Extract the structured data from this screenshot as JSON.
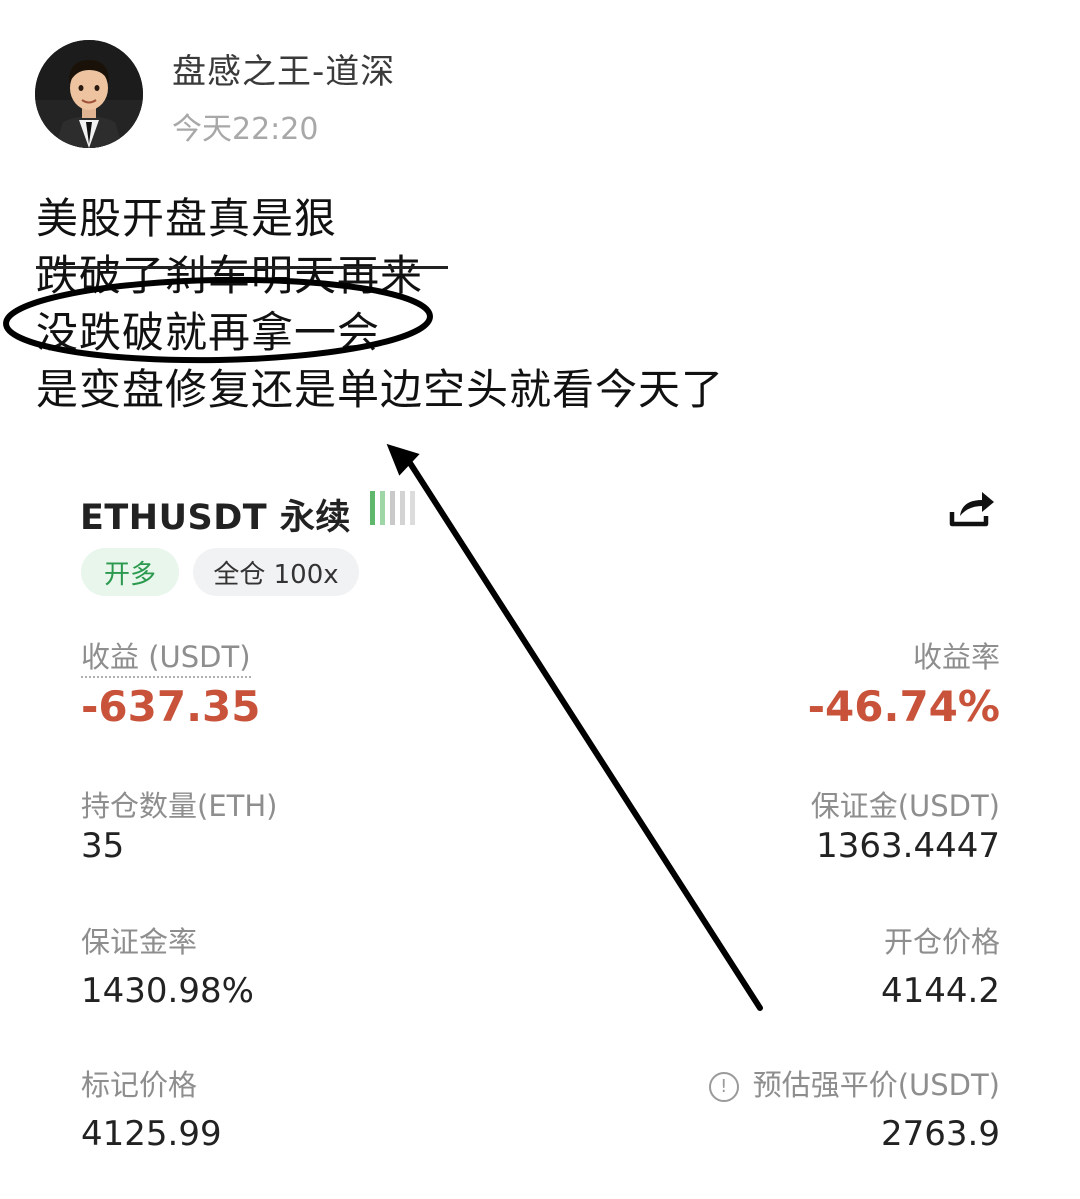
{
  "post": {
    "author": "盘感之王-道深",
    "time": "今天22:20",
    "lines": [
      "美股开盘真是狠",
      "跌破了刹车明天再来",
      "没跌破就再拿一会",
      "是变盘修复还是单边空头就看今天了"
    ]
  },
  "position": {
    "pair": "ETHUSDT 永续",
    "direction_badge": "开多",
    "margin_badge": "全仓 100x",
    "pnl_label": "收益 (USDT)",
    "pnl_value": "-637.35",
    "roe_label": "收益率",
    "roe_value": "-46.74%",
    "size_label": "持仓数量(ETH)",
    "size_value": "35",
    "margin_label": "保证金(USDT)",
    "margin_value": "1363.4447",
    "margin_ratio_label": "保证金率",
    "margin_ratio_value": "1430.98%",
    "entry_label": "开仓价格",
    "entry_value": "4144.2",
    "mark_label": "标记价格",
    "mark_value": "4125.99",
    "liq_label": "预估强平价(USDT)",
    "liq_value": "2763.9"
  },
  "icons": {
    "signal": "signal-strength-icon",
    "share": "share-icon",
    "info": "info-icon"
  },
  "colors": {
    "loss": "#c8533a",
    "long_green": "#2b9a4f",
    "long_badge_bg": "#e8f6ec",
    "label_gray": "#8e8e8e"
  }
}
